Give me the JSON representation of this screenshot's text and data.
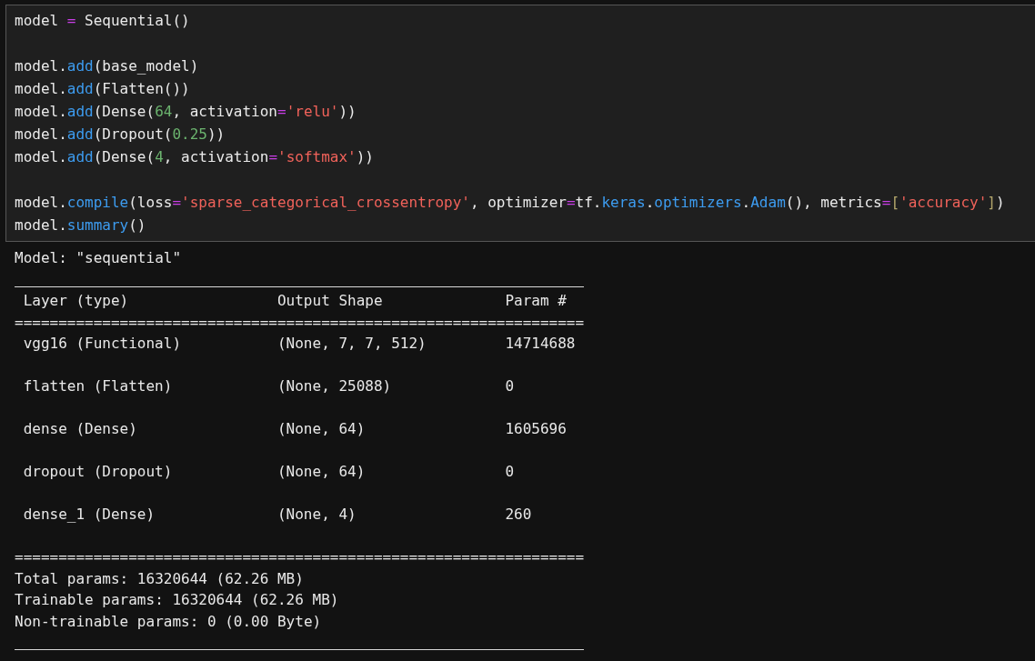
{
  "code_cell": {
    "lines": [
      {
        "kind": "code",
        "tokens": [
          {
            "kind": "text",
            "text": "model "
          },
          {
            "kind": "op",
            "text": "="
          },
          {
            "kind": "text",
            "text": " Sequential()"
          }
        ]
      },
      {
        "kind": "blank"
      },
      {
        "kind": "code",
        "tokens": [
          {
            "kind": "text",
            "text": "model."
          },
          {
            "kind": "func",
            "text": "add"
          },
          {
            "kind": "text",
            "text": "(base_model)"
          }
        ]
      },
      {
        "kind": "code",
        "tokens": [
          {
            "kind": "text",
            "text": "model."
          },
          {
            "kind": "func",
            "text": "add"
          },
          {
            "kind": "text",
            "text": "(Flatten())"
          }
        ]
      },
      {
        "kind": "code",
        "tokens": [
          {
            "kind": "text",
            "text": "model."
          },
          {
            "kind": "func",
            "text": "add"
          },
          {
            "kind": "text",
            "text": "(Dense("
          },
          {
            "kind": "num",
            "text": "64"
          },
          {
            "kind": "text",
            "text": ", activation"
          },
          {
            "kind": "op",
            "text": "="
          },
          {
            "kind": "str",
            "text": "'relu'"
          },
          {
            "kind": "text",
            "text": "))"
          }
        ]
      },
      {
        "kind": "code",
        "tokens": [
          {
            "kind": "text",
            "text": "model."
          },
          {
            "kind": "func",
            "text": "add"
          },
          {
            "kind": "text",
            "text": "(Dropout("
          },
          {
            "kind": "num",
            "text": "0.25"
          },
          {
            "kind": "text",
            "text": "))"
          }
        ]
      },
      {
        "kind": "code",
        "tokens": [
          {
            "kind": "text",
            "text": "model."
          },
          {
            "kind": "func",
            "text": "add"
          },
          {
            "kind": "text",
            "text": "(Dense("
          },
          {
            "kind": "num",
            "text": "4"
          },
          {
            "kind": "text",
            "text": ", activation"
          },
          {
            "kind": "op",
            "text": "="
          },
          {
            "kind": "str",
            "text": "'softmax'"
          },
          {
            "kind": "text",
            "text": "))"
          }
        ]
      },
      {
        "kind": "blank"
      },
      {
        "kind": "code",
        "tokens": [
          {
            "kind": "text",
            "text": "model."
          },
          {
            "kind": "func",
            "text": "compile"
          },
          {
            "kind": "text",
            "text": "(loss"
          },
          {
            "kind": "op",
            "text": "="
          },
          {
            "kind": "str",
            "text": "'sparse_categorical_crossentropy'"
          },
          {
            "kind": "text",
            "text": ", optimizer"
          },
          {
            "kind": "op",
            "text": "="
          },
          {
            "kind": "text",
            "text": "tf."
          },
          {
            "kind": "func",
            "text": "keras"
          },
          {
            "kind": "text",
            "text": "."
          },
          {
            "kind": "func",
            "text": "optimizers"
          },
          {
            "kind": "text",
            "text": "."
          },
          {
            "kind": "func",
            "text": "Adam"
          },
          {
            "kind": "text",
            "text": "(), metrics"
          },
          {
            "kind": "op",
            "text": "="
          },
          {
            "kind": "bracket",
            "text": "["
          },
          {
            "kind": "str",
            "text": "'accuracy'"
          },
          {
            "kind": "bracket",
            "text": "]"
          },
          {
            "kind": "text",
            "text": ")"
          }
        ]
      },
      {
        "kind": "code",
        "tokens": [
          {
            "kind": "text",
            "text": "model."
          },
          {
            "kind": "func",
            "text": "summary"
          },
          {
            "kind": "text",
            "text": "()"
          }
        ]
      }
    ]
  },
  "output": {
    "title": "Model: \"sequential\"",
    "table": {
      "columns": [
        "Layer (type)",
        "Output Shape",
        "Param #"
      ],
      "header_rule": "=================================================================",
      "rows": [
        [
          "vgg16 (Functional)",
          "(None, 7, 7, 512)",
          "14714688"
        ],
        [
          "flatten (Flatten)",
          "(None, 25088)",
          "0"
        ],
        [
          "dense (Dense)",
          "(None, 64)",
          "1605696"
        ],
        [
          "dropout (Dropout)",
          "(None, 64)",
          "0"
        ],
        [
          "dense_1 (Dense)",
          "(None, 4)",
          "260"
        ]
      ],
      "footer_rule": "================================================================="
    },
    "totals": [
      "Total params: 16320644 (62.26 MB)",
      "Trainable params: 16320644 (62.26 MB)",
      "Non-trainable params: 0 (0.00 Byte)"
    ]
  }
}
